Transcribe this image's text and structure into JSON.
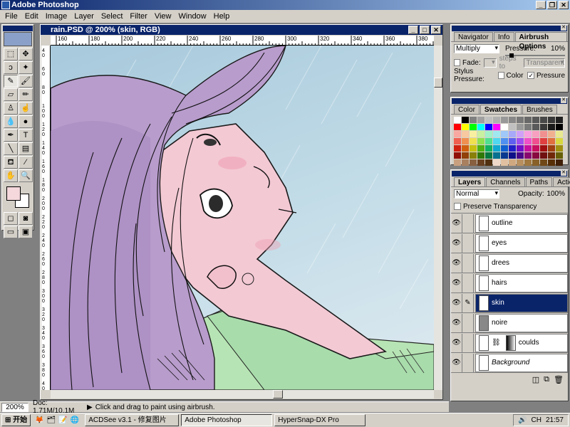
{
  "app": {
    "title": "Adobe Photoshop"
  },
  "menu": [
    "File",
    "Edit",
    "Image",
    "Layer",
    "Select",
    "Filter",
    "View",
    "Window",
    "Help"
  ],
  "document": {
    "title": "rain.PSD @ 200% (skin, RGB)",
    "ruler_h": [
      "160",
      "180",
      "200",
      "220",
      "240",
      "260",
      "280",
      "300",
      "320",
      "340",
      "360",
      "380"
    ],
    "ruler_v": [
      "4 0",
      "6 0",
      "8 0",
      "1 0 0",
      "1 2 0",
      "1 4 0",
      "1 6 0",
      "1 8 0",
      "2 0 0",
      "2 2 0",
      "2 4 0",
      "2 6 0",
      "2 8 0",
      "3 0 0",
      "3 2 0",
      "3 4 0",
      "3 6 0",
      "3 8 0",
      "4 0 0"
    ]
  },
  "status": {
    "zoom": "200%",
    "doc": "Doc: 1.71M/10.1M",
    "hint": "Click and drag to paint using airbrush."
  },
  "airbrush": {
    "tabs": [
      "Navigator",
      "Info",
      "Airbrush Options"
    ],
    "mode": "Multiply",
    "pressure_label": "Pressure:",
    "pressure_value": "10%",
    "fade_label": "Fade:",
    "steps_label": "steps to",
    "fade_to": "Transparent",
    "stylus_label": "Stylus Pressure:",
    "color_label": "Color",
    "pressure_check_label": "Pressure"
  },
  "swatches_panel": {
    "tabs": [
      "Color",
      "Swatches",
      "Brushes"
    ],
    "colors": [
      "#ffffff",
      "#000000",
      "#808080",
      "#a0a0a0",
      "#c0c0c0",
      "#b0b0b0",
      "#989898",
      "#888888",
      "#787878",
      "#686868",
      "#585858",
      "#484848",
      "#383838",
      "#202020",
      "#ff0000",
      "#ffff00",
      "#00ff00",
      "#00ffff",
      "#0000ff",
      "#ff00ff",
      "#ffffff",
      "#c0c0c0",
      "#9a9a9a",
      "#7a7a7a",
      "#5a5a5a",
      "#3a3a3a",
      "#1a1a1a",
      "#000000",
      "#f8a8a0",
      "#f8c8a0",
      "#f8f0a0",
      "#c8f0a0",
      "#a0f0c8",
      "#a0e8f0",
      "#a0c8f8",
      "#a8a8f8",
      "#d0a0f8",
      "#f8a0e0",
      "#f8a0c0",
      "#f09090",
      "#f0b090",
      "#e8e890",
      "#f06050",
      "#f09050",
      "#f0e050",
      "#90e050",
      "#50e090",
      "#50d8f0",
      "#5090f0",
      "#6060f0",
      "#a050f0",
      "#f050c8",
      "#f05090",
      "#e04040",
      "#e07040",
      "#d8d840",
      "#d02010",
      "#d06010",
      "#c8c010",
      "#50b010",
      "#10b060",
      "#10a8d0",
      "#1060d0",
      "#2020c8",
      "#7010c8",
      "#c810a0",
      "#c81060",
      "#a01010",
      "#a04010",
      "#a09010",
      "#901008",
      "#904008",
      "#888008",
      "#307808",
      "#087840",
      "#087090",
      "#083890",
      "#101088",
      "#480888",
      "#880870",
      "#880840",
      "#701010",
      "#702808",
      "#686008",
      "#c8a080",
      "#a88060",
      "#886040",
      "#684020",
      "#503010",
      "#f0d8c8",
      "#e0c0a0",
      "#d0a880",
      "#b89060",
      "#a07840",
      "#886028",
      "#704818",
      "#583008",
      "#402008"
    ]
  },
  "layers_panel": {
    "tabs": [
      "Layers",
      "Channels",
      "Paths",
      "Actions"
    ],
    "mode": "Normal",
    "opacity_label": "Opacity:",
    "opacity_value": "100%",
    "preserve_label": "Preserve Transparency",
    "layers": [
      {
        "name": "outline",
        "active": false
      },
      {
        "name": "eyes",
        "active": false
      },
      {
        "name": "drees",
        "active": false
      },
      {
        "name": "hairs",
        "active": false
      },
      {
        "name": "skin",
        "active": true
      },
      {
        "name": "noire",
        "active": false
      },
      {
        "name": "coulds",
        "active": false
      },
      {
        "name": "Background",
        "active": false
      }
    ]
  },
  "taskbar": {
    "start": "开始",
    "items": [
      "ACDSee v3.1 - 修复图片",
      "Adobe Photoshop",
      "HyperSnap-DX Pro"
    ],
    "lang": "CH",
    "clock": "21:57"
  }
}
